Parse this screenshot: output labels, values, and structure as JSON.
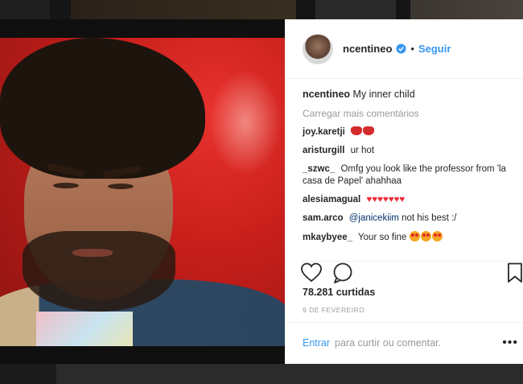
{
  "post": {
    "username": "ncentineo",
    "follow_label": "Seguir",
    "separator": "•",
    "caption_text": "My inner child",
    "load_more_label": "Carregar mais comentários",
    "comments": [
      {
        "user": "joy.karetji",
        "text": ""
      },
      {
        "user": "aristurgill",
        "text": "ur hot"
      },
      {
        "user": "_szwc_",
        "text": "Omfg you look like the professor from 'la casa de Papel' ahahhaa"
      },
      {
        "user": "alesiamagual",
        "text": ""
      },
      {
        "user": "sam.arco",
        "mention": "@janicekiim",
        "text": "not his best :/"
      },
      {
        "user": "mkaybyee_",
        "text": "Your so fine"
      }
    ],
    "likes": "78.281 curtidas",
    "date": "9 DE FEVEREIRO",
    "login_label": "Entrar",
    "login_hint": "para curtir ou comentar.",
    "more_label": "•••"
  },
  "icons": {
    "verified": "verified-badge-icon",
    "like": "heart-outline-icon",
    "comment": "comment-bubble-icon",
    "save": "bookmark-icon"
  },
  "colors": {
    "link": "#3897f0",
    "text": "#262626",
    "muted": "#999999",
    "heart": "#ed2c3a"
  }
}
